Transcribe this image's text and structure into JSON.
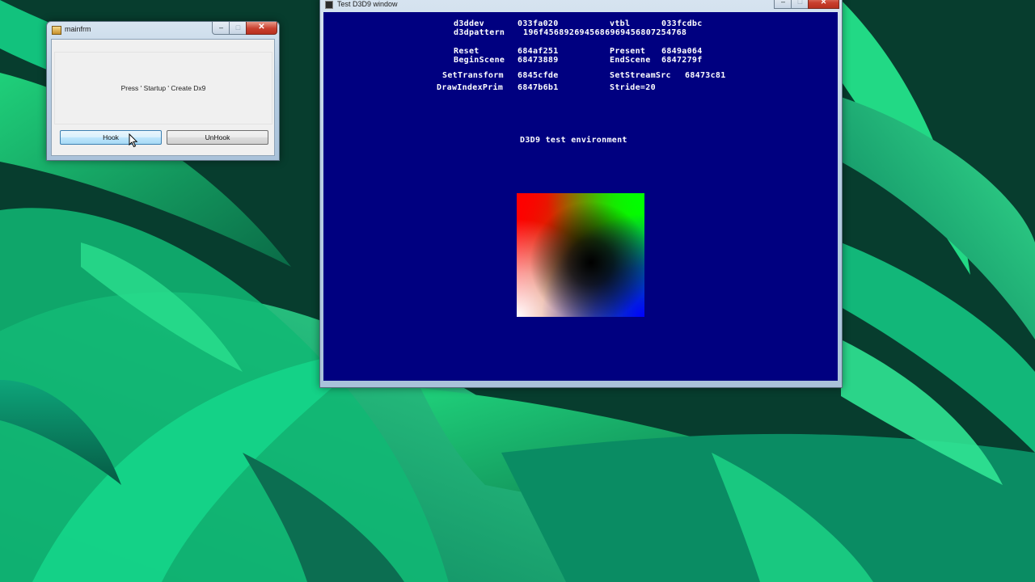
{
  "mainfrm": {
    "title": "mainfrm",
    "status_label": "Press ' Startup ' Create Dx9",
    "hook_label": "Hook",
    "unhook_label": "UnHook",
    "min_glyph": "–",
    "max_glyph": "□",
    "close_glyph": "✕"
  },
  "d3d_window": {
    "title": "Test D3D9 window",
    "min_glyph": "–",
    "max_glyph": "□",
    "close_glyph": "✕",
    "info": {
      "d3ddev_label": "d3ddev",
      "d3ddev_value": "033fa020",
      "vtbl_label": "vtbl",
      "vtbl_value": "033fcdbc",
      "pattern_label": "d3dpattern",
      "pattern_value": "196f4568926945686969456807254768",
      "reset_label": "Reset",
      "reset_value": "684af251",
      "present_label": "Present",
      "present_value": "6849a064",
      "beginscene_label": "BeginScene",
      "beginscene_value": "68473889",
      "endscene_label": "EndScene",
      "endscene_value": "6847279f",
      "settransform_label": "SetTransform",
      "settransform_value": "6845cfde",
      "setstreamsrc_label": "SetStreamSrc",
      "setstreamsrc_value": "68473c81",
      "drawindexprim_label": "DrawIndexPrim",
      "drawindexprim_value": "6847b6b1",
      "stride_text": "Stride=20"
    },
    "environment_text": "D3D9 test environment"
  },
  "colors": {
    "render_background": "#000080",
    "hook_button_accent": "#bee6fd",
    "close_button": "#c9402e"
  }
}
